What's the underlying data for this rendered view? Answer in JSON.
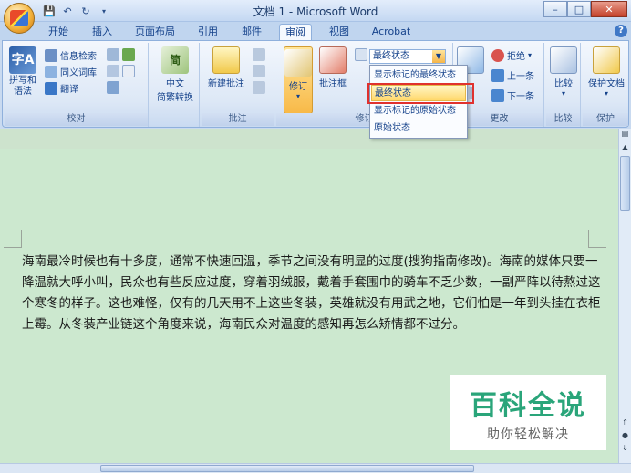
{
  "window": {
    "title": "文档 1 - Microsoft Word"
  },
  "qat": {
    "save_icon": "save-icon",
    "undo_icon": "undo-icon",
    "redo_icon": "redo-icon"
  },
  "tabs": [
    {
      "label": "开始"
    },
    {
      "label": "插入"
    },
    {
      "label": "页面布局"
    },
    {
      "label": "引用"
    },
    {
      "label": "邮件"
    },
    {
      "label": "审阅"
    },
    {
      "label": "视图"
    },
    {
      "label": "Acrobat"
    }
  ],
  "ribbon": {
    "proofing": {
      "label": "校对",
      "spelling": "拼写和\n语法",
      "research": "信息检索",
      "thesaurus": "同义词库",
      "translate": "翻译"
    },
    "chinese": {
      "label": "中文简繁转换",
      "btn_line1": "中文",
      "btn_line2": "简繁转换"
    },
    "comments": {
      "label": "批注",
      "new_comment": "新建批注"
    },
    "tracking": {
      "label": "修订",
      "track_changes": "修订",
      "balloons": "批注框",
      "display_combo": "最终状态"
    },
    "changes": {
      "label": "更改",
      "reject": "拒绝",
      "previous": "上一条",
      "next": "下一条"
    },
    "compare": {
      "label": "比较",
      "btn": "比较"
    },
    "protect": {
      "label": "保护",
      "btn": "保护文档"
    }
  },
  "dropdown": {
    "items": [
      {
        "label": "显示标记的最终状态"
      },
      {
        "label": "最终状态"
      },
      {
        "label": "显示标记的原始状态"
      },
      {
        "label": "原始状态"
      }
    ],
    "selected_index": 1
  },
  "document": {
    "paragraph": "海南最冷时候也有十多度，通常不快速回温，季节之间没有明显的过度(搜狗指南修改)。海南的媒体只要一降温就大呼小叫，民众也有些反应过度，穿着羽绒服，戴着手套围巾的骑车不乏少数，一副严阵以待熬过这个寒冬的样子。这也难怪，仅有的几天用不上这些冬装，英雄就没有用武之地，它们怕是一年到头挂在衣柜上霉。从冬装产业链这个角度来说，海南民众对温度的感知再怎么矫情都不过分。"
  },
  "watermark": {
    "title": "百科全说",
    "subtitle": "助你轻松解决"
  },
  "colors": {
    "accent": "#15428b",
    "document_bg": "#cce8cf",
    "highlight": "#ffd86b",
    "annotation_red": "#e0312e",
    "watermark_green": "#2aa57a"
  }
}
